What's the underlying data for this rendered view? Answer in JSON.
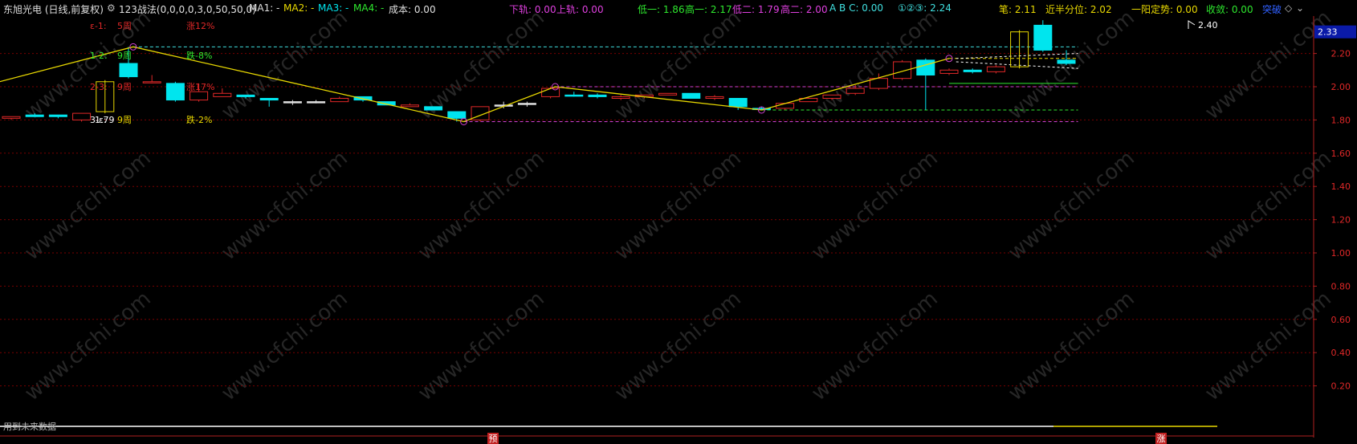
{
  "header": {
    "stock_label": "东旭光电 (日线,前复权)",
    "settings_icon": "gear-icon",
    "indicator_label": "123战法(0,0,0,0,3,0,50,50,0)",
    "ma1": "MA1: -",
    "ma2": "MA2: -",
    "ma3": "MA3: -",
    "ma4": "MA4: -",
    "cost": "成本: 0.00",
    "lower_band": "下轨: 0.00",
    "upper_band": "上轨: 0.00",
    "low1": "低一: 1.86",
    "high1": "高一: 2.17",
    "low2": "低二: 1.79",
    "high2": "高二: 2.00",
    "abc": "A B C: 0.00",
    "circled": "①②③: 2.24",
    "bi": "笔: 2.11",
    "near_half": "近半分位: 2.02",
    "yiyang": "一阳定势: 0.00",
    "shoulian": "收敛: 0.00",
    "tupo": "突破"
  },
  "price_tag": "2.33",
  "high_tag": "2.40",
  "bottom_note": "用到未来数据",
  "markers": [
    "预",
    "涨"
  ],
  "watermark": "www.cfchi.com",
  "wave_notes": [
    {
      "label": "ε-1:",
      "weeks": "5周",
      "pct": "涨12%",
      "color": "#e02828"
    },
    {
      "label": "1-2:",
      "weeks": "9周",
      "pct": "跌-8%",
      "color": "#2ee82e"
    },
    {
      "label": "2-3:",
      "weeks": "9周",
      "pct": "涨17%",
      "color": "#e02828"
    },
    {
      "label": "3-ε:",
      "weeks": "9周",
      "pct": "跌-2%",
      "color": "#e8d800"
    }
  ],
  "wave_low_text": "1.79",
  "colors": {
    "up": "#e02828",
    "down": "#00e5ee",
    "flat": "#e0e0e0",
    "wave": "#e8d800",
    "box": "#e8d800",
    "magenta": "#d040d0",
    "grid": "#7a0000"
  },
  "chart_data": {
    "type": "candlestick",
    "y_ticks": [
      2.2,
      2.0,
      1.8,
      1.6,
      1.4,
      1.2,
      1.0,
      0.8,
      0.6,
      0.4,
      0.2
    ],
    "y_tick_labels": [
      "2.20",
      "2.00",
      "1.80",
      "1.60",
      "1.40",
      "1.20",
      "1.00",
      "0.80",
      "0.60",
      "0.40",
      "0.20"
    ],
    "ylim": [
      0.0,
      2.4
    ],
    "last_price": 2.33,
    "candles": [
      {
        "o": 1.81,
        "h": 1.82,
        "l": 1.8,
        "c": 1.82,
        "t": "up"
      },
      {
        "o": 1.83,
        "h": 1.84,
        "l": 1.82,
        "c": 1.82,
        "t": "down"
      },
      {
        "o": 1.83,
        "h": 1.83,
        "l": 1.81,
        "c": 1.82,
        "t": "down"
      },
      {
        "o": 1.8,
        "h": 1.84,
        "l": 1.79,
        "c": 1.84,
        "t": "up"
      },
      {
        "o": 1.85,
        "h": 2.04,
        "l": 1.84,
        "c": 2.03,
        "t": "box"
      },
      {
        "o": 2.14,
        "h": 2.24,
        "l": 2.05,
        "c": 2.06,
        "t": "down"
      },
      {
        "o": 2.03,
        "h": 2.07,
        "l": 2.02,
        "c": 2.03,
        "t": "up"
      },
      {
        "o": 2.02,
        "h": 2.03,
        "l": 1.91,
        "c": 1.92,
        "t": "down"
      },
      {
        "o": 1.92,
        "h": 2.02,
        "l": 1.91,
        "c": 1.97,
        "t": "up"
      },
      {
        "o": 1.94,
        "h": 1.99,
        "l": 1.94,
        "c": 1.96,
        "t": "up"
      },
      {
        "o": 1.95,
        "h": 1.95,
        "l": 1.93,
        "c": 1.94,
        "t": "down"
      },
      {
        "o": 1.93,
        "h": 1.93,
        "l": 1.88,
        "c": 1.92,
        "t": "down"
      },
      {
        "o": 1.91,
        "h": 1.92,
        "l": 1.89,
        "c": 1.91,
        "t": "flat"
      },
      {
        "o": 1.91,
        "h": 1.92,
        "l": 1.9,
        "c": 1.91,
        "t": "flat"
      },
      {
        "o": 1.91,
        "h": 1.94,
        "l": 1.91,
        "c": 1.93,
        "t": "up"
      },
      {
        "o": 1.94,
        "h": 1.94,
        "l": 1.91,
        "c": 1.92,
        "t": "down"
      },
      {
        "o": 1.91,
        "h": 1.91,
        "l": 1.89,
        "c": 1.89,
        "t": "down"
      },
      {
        "o": 1.88,
        "h": 1.9,
        "l": 1.88,
        "c": 1.89,
        "t": "up"
      },
      {
        "o": 1.88,
        "h": 1.88,
        "l": 1.86,
        "c": 1.86,
        "t": "down"
      },
      {
        "o": 1.85,
        "h": 1.85,
        "l": 1.79,
        "c": 1.81,
        "t": "down"
      },
      {
        "o": 1.8,
        "h": 1.88,
        "l": 1.79,
        "c": 1.88,
        "t": "up"
      },
      {
        "o": 1.89,
        "h": 1.91,
        "l": 1.87,
        "c": 1.89,
        "t": "flat"
      },
      {
        "o": 1.9,
        "h": 1.91,
        "l": 1.88,
        "c": 1.9,
        "t": "flat"
      },
      {
        "o": 1.94,
        "h": 2.0,
        "l": 1.93,
        "c": 1.99,
        "t": "up"
      },
      {
        "o": 1.95,
        "h": 1.97,
        "l": 1.94,
        "c": 1.95,
        "t": "down"
      },
      {
        "o": 1.95,
        "h": 1.96,
        "l": 1.93,
        "c": 1.94,
        "t": "down"
      },
      {
        "o": 1.93,
        "h": 1.95,
        "l": 1.92,
        "c": 1.94,
        "t": "up"
      },
      {
        "o": 1.94,
        "h": 1.95,
        "l": 1.93,
        "c": 1.95,
        "t": "up"
      },
      {
        "o": 1.95,
        "h": 1.96,
        "l": 1.95,
        "c": 1.96,
        "t": "up"
      },
      {
        "o": 1.96,
        "h": 1.96,
        "l": 1.93,
        "c": 1.93,
        "t": "down"
      },
      {
        "o": 1.93,
        "h": 1.95,
        "l": 1.92,
        "c": 1.94,
        "t": "up"
      },
      {
        "o": 1.93,
        "h": 1.93,
        "l": 1.86,
        "c": 1.88,
        "t": "down"
      },
      {
        "o": 1.87,
        "h": 1.88,
        "l": 1.86,
        "c": 1.87,
        "t": "down"
      },
      {
        "o": 1.87,
        "h": 1.9,
        "l": 1.86,
        "c": 1.9,
        "t": "up"
      },
      {
        "o": 1.91,
        "h": 1.94,
        "l": 1.91,
        "c": 1.93,
        "t": "up"
      },
      {
        "o": 1.93,
        "h": 1.95,
        "l": 1.92,
        "c": 1.95,
        "t": "up"
      },
      {
        "o": 1.96,
        "h": 2.01,
        "l": 1.95,
        "c": 1.99,
        "t": "up"
      },
      {
        "o": 1.99,
        "h": 2.08,
        "l": 1.98,
        "c": 2.05,
        "t": "up"
      },
      {
        "o": 2.05,
        "h": 2.16,
        "l": 2.04,
        "c": 2.15,
        "t": "up"
      },
      {
        "o": 2.16,
        "h": 2.17,
        "l": 1.86,
        "c": 2.07,
        "t": "down"
      },
      {
        "o": 2.08,
        "h": 2.11,
        "l": 2.07,
        "c": 2.1,
        "t": "up"
      },
      {
        "o": 2.1,
        "h": 2.11,
        "l": 2.08,
        "c": 2.09,
        "t": "down"
      },
      {
        "o": 2.09,
        "h": 2.13,
        "l": 2.08,
        "c": 2.12,
        "t": "up"
      },
      {
        "o": 2.12,
        "h": 2.34,
        "l": 2.11,
        "c": 2.33,
        "t": "box"
      },
      {
        "o": 2.37,
        "h": 2.4,
        "l": 2.21,
        "c": 2.22,
        "t": "down"
      },
      {
        "o": 2.16,
        "h": 2.22,
        "l": 2.13,
        "c": 2.14,
        "t": "down"
      }
    ],
    "wave_points": [
      {
        "i": -0.5,
        "v": 2.03
      },
      {
        "i": 5.2,
        "v": 2.24
      },
      {
        "i": 19.3,
        "v": 1.79
      },
      {
        "i": 23.2,
        "v": 2.0
      },
      {
        "i": 32.0,
        "v": 1.86
      },
      {
        "i": 40.0,
        "v": 2.17
      }
    ],
    "levels": [
      {
        "v": 2.24,
        "from": 5.2,
        "to": 45.5,
        "color": "#40e0e0",
        "style": "dashed"
      },
      {
        "v": 2.17,
        "from": 40.0,
        "to": 45.5,
        "color": "#e8d800",
        "style": "dashed"
      },
      {
        "v": 2.0,
        "from": 23.2,
        "to": 45.5,
        "color": "#d040d0",
        "style": "dashed"
      },
      {
        "v": 2.02,
        "from": 40.0,
        "to": 45.5,
        "color": "#2ee82e",
        "style": "solid"
      },
      {
        "v": 1.79,
        "from": 19.3,
        "to": 45.5,
        "color": "#d040d0",
        "style": "dashed"
      },
      {
        "v": 1.86,
        "from": 32.0,
        "to": 45.5,
        "color": "#2ee82e",
        "style": "dashed"
      }
    ]
  }
}
